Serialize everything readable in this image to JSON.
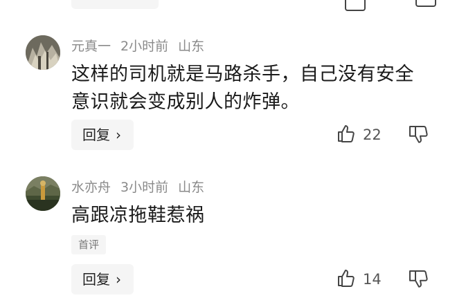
{
  "comments": [
    {
      "username": "元真一",
      "time": "2小时前",
      "location": "山东",
      "text": "这样的司机就是马路杀手，自己没有安全意识就会变成别人的炸弹。",
      "reply_label": "回复",
      "likes": "22",
      "badge": ""
    },
    {
      "username": "水亦舟",
      "time": "3小时前",
      "location": "山东",
      "text": "高跟凉拖鞋惹祸",
      "reply_label": "回复",
      "likes": "14",
      "badge": "首评"
    }
  ],
  "icons": {
    "reply_chevron": "chevron-right-icon",
    "like": "thumbs-up-icon",
    "dislike": "thumbs-down-icon"
  }
}
